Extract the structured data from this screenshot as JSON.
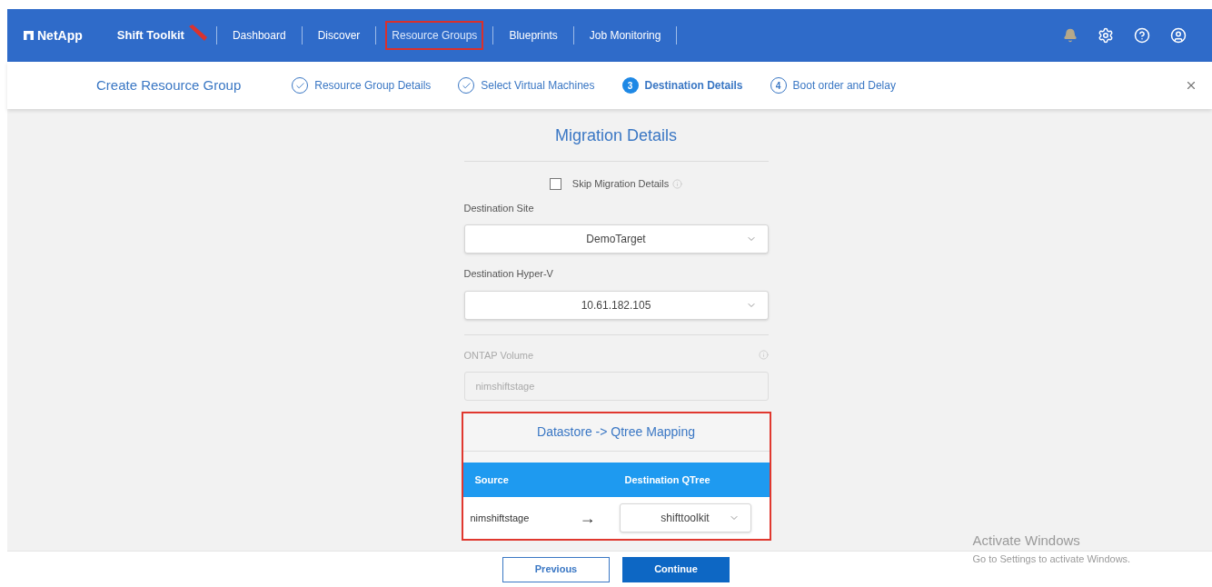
{
  "app": {
    "logo": "NetApp",
    "product": "Shift Toolkit"
  },
  "nav": [
    {
      "label": "Dashboard",
      "selected": false
    },
    {
      "label": "Discover",
      "selected": false
    },
    {
      "label": "Resource Groups",
      "selected": true
    },
    {
      "label": "Blueprints",
      "selected": false
    },
    {
      "label": "Job Monitoring",
      "selected": false
    }
  ],
  "wizard": {
    "title": "Create Resource Group",
    "steps": [
      {
        "label": "Resource Group Details",
        "kind": "done"
      },
      {
        "label": "Select Virtual Machines",
        "kind": "done"
      },
      {
        "number": "3",
        "label": "Destination Details",
        "kind": "current"
      },
      {
        "number": "4",
        "label": "Boot order and Delay",
        "kind": "pending"
      }
    ]
  },
  "form": {
    "title": "Migration Details",
    "skip": {
      "label": "Skip Migration Details",
      "checked": false
    },
    "destination_site": {
      "label": "Destination Site",
      "value": "DemoTarget"
    },
    "destination_hyperv": {
      "label": "Destination Hyper-V",
      "value": "10.61.182.105"
    },
    "ontap_volume": {
      "label": "ONTAP Volume",
      "value": "nimshiftstage",
      "disabled": true
    },
    "mapping": {
      "title": "Datastore -> Qtree Mapping",
      "columns": [
        "Source",
        "Destination QTree"
      ],
      "rows": [
        {
          "source": "nimshiftstage",
          "arrow": "→",
          "destination": "shifttoolkit"
        }
      ]
    }
  },
  "buttons": [
    {
      "label": "Previous",
      "kind": "secondary"
    },
    {
      "label": "Continue",
      "kind": "primary"
    }
  ],
  "watermark": {
    "title": "Activate Windows",
    "text": "Go to Settings to activate Windows."
  }
}
